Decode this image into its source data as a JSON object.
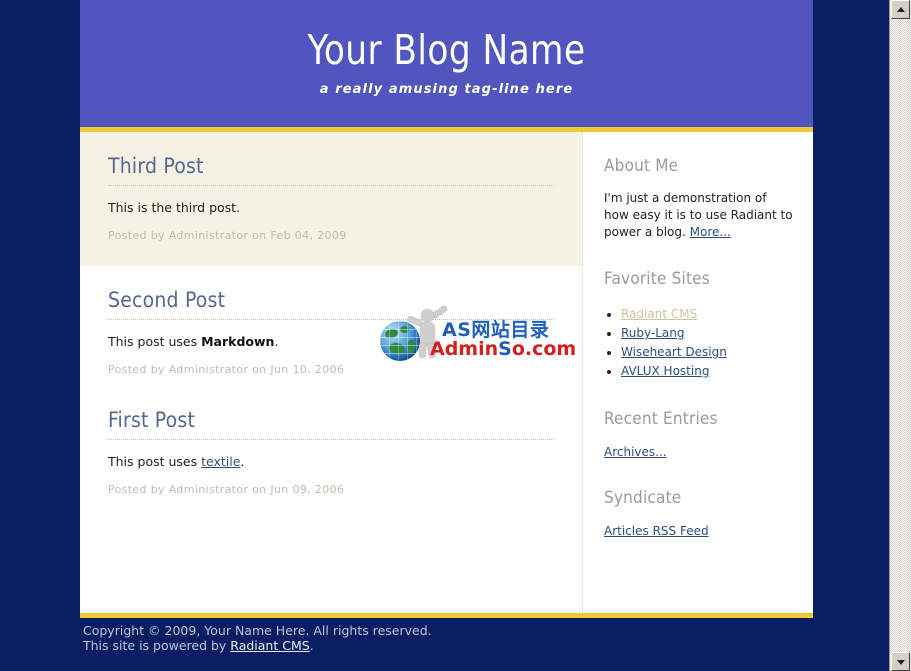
{
  "header": {
    "title": "Your Blog Name",
    "tagline": "a really amusing tag-line here"
  },
  "posts": [
    {
      "title": "Third Post",
      "body_prefix": "This is the third post.",
      "body_link": "",
      "body_bold": "",
      "body_suffix": "",
      "meta": "Posted by Administrator on Feb 04, 2009"
    },
    {
      "title": "Second Post",
      "body_prefix": "This post uses ",
      "body_bold": "Markdown",
      "body_link": "",
      "body_suffix": ".",
      "meta": "Posted by Administrator on Jun 10, 2006"
    },
    {
      "title": "First Post",
      "body_prefix": "This post uses ",
      "body_bold": "",
      "body_link": "textile",
      "body_suffix": ".",
      "meta": "Posted by Administrator on Jun 09, 2006"
    }
  ],
  "sidebar": {
    "about": {
      "heading": "About Me",
      "text": "I'm just a demonstration of how easy it is to use Radiant to power a blog. ",
      "more_link": "More..."
    },
    "favorites": {
      "heading": "Favorite Sites",
      "items": [
        {
          "label": "Radiant CMS",
          "state": "visited"
        },
        {
          "label": "Ruby-Lang",
          "state": "normal"
        },
        {
          "label": "Wiseheart Design",
          "state": "normal"
        },
        {
          "label": "AVLUX Hosting",
          "state": "normal"
        }
      ]
    },
    "recent": {
      "heading": "Recent Entries",
      "link": "Archives..."
    },
    "syndicate": {
      "heading": "Syndicate",
      "link": "Articles RSS Feed"
    }
  },
  "footer": {
    "line1": "Copyright © 2009, Your Name Here. All rights reserved.",
    "line2_prefix": "This site is powered by ",
    "line2_link": "Radiant CMS",
    "line2_suffix": "."
  },
  "watermark": {
    "chinese": "AS网站目录",
    "domain_a": "Admin",
    "domain_s": "S",
    "domain_o": "o.com"
  },
  "colors": {
    "page_background": "#0a1f63",
    "header_background": "#5055bf",
    "accent_yellow": "#f1c832",
    "featured_post_background": "#f5f1e4",
    "heading_blue": "#56688f",
    "link_blue": "#2f4f7f",
    "visited_link": "#cfc49b",
    "meta_grey": "#c2bcac"
  },
  "scrollbar": {
    "up_arrow": "scroll-up-arrow",
    "down_arrow": "scroll-down-arrow"
  }
}
